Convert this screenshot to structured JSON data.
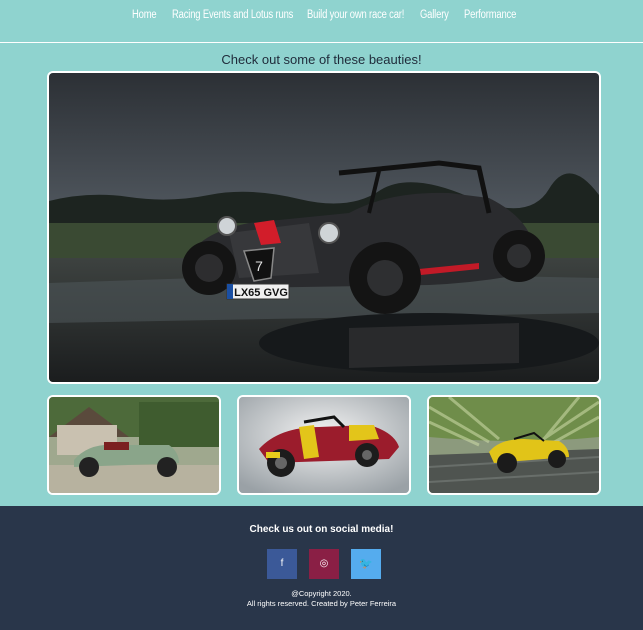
{
  "nav": {
    "items": [
      {
        "label": "Home"
      },
      {
        "label": "Racing Events and Lotus runs"
      },
      {
        "label": "Build your own race car!"
      },
      {
        "label": "Gallery"
      },
      {
        "label": "Performance"
      }
    ]
  },
  "main": {
    "heading": "Check out some of these beauties!",
    "hero_plate": "LX65 GVG",
    "hero_badge": "7"
  },
  "footer": {
    "title": "Check us out on social media!",
    "social": [
      {
        "name": "facebook",
        "glyph": "f",
        "color": "#3b5998"
      },
      {
        "name": "instagram",
        "glyph": "◎",
        "color": "#8a1f45"
      },
      {
        "name": "twitter",
        "glyph": "🐦",
        "color": "#55acee"
      }
    ],
    "copyright": "@Copyright 2020.",
    "rights": "All rights reserved. Created by Peter Ferreira"
  },
  "colors": {
    "background": "#8fd3cf",
    "footer": "#29364a"
  }
}
